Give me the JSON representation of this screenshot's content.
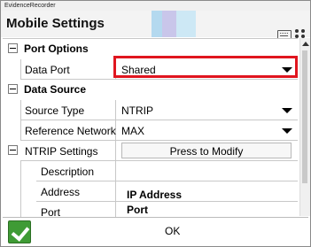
{
  "window": {
    "title": "EvidenceRecorder"
  },
  "header": {
    "title": "Mobile Settings",
    "stripe_colors": [
      "#b4d9ef",
      "#c9c6ea",
      "#cde8f5"
    ]
  },
  "grid": {
    "port_options": {
      "label": "Port Options",
      "data_port": {
        "name": "Data Port",
        "value": "Shared"
      }
    },
    "data_source": {
      "label": "Data Source",
      "source_type": {
        "name": "Source Type",
        "value": "NTRIP"
      },
      "reference_network": {
        "name": "Reference Network",
        "value": "MAX"
      },
      "ntrip_settings": {
        "name": "NTRIP Settings",
        "button": "Press to Modify"
      },
      "description": {
        "name": "Description",
        "value": ""
      },
      "address": {
        "name": "Address",
        "value": "IP Address"
      },
      "port": {
        "name": "Port",
        "value": "Port"
      }
    }
  },
  "footer": {
    "ok_label": "OK"
  },
  "colors": {
    "highlight": "#e0151f",
    "check": "#3f9b35"
  }
}
